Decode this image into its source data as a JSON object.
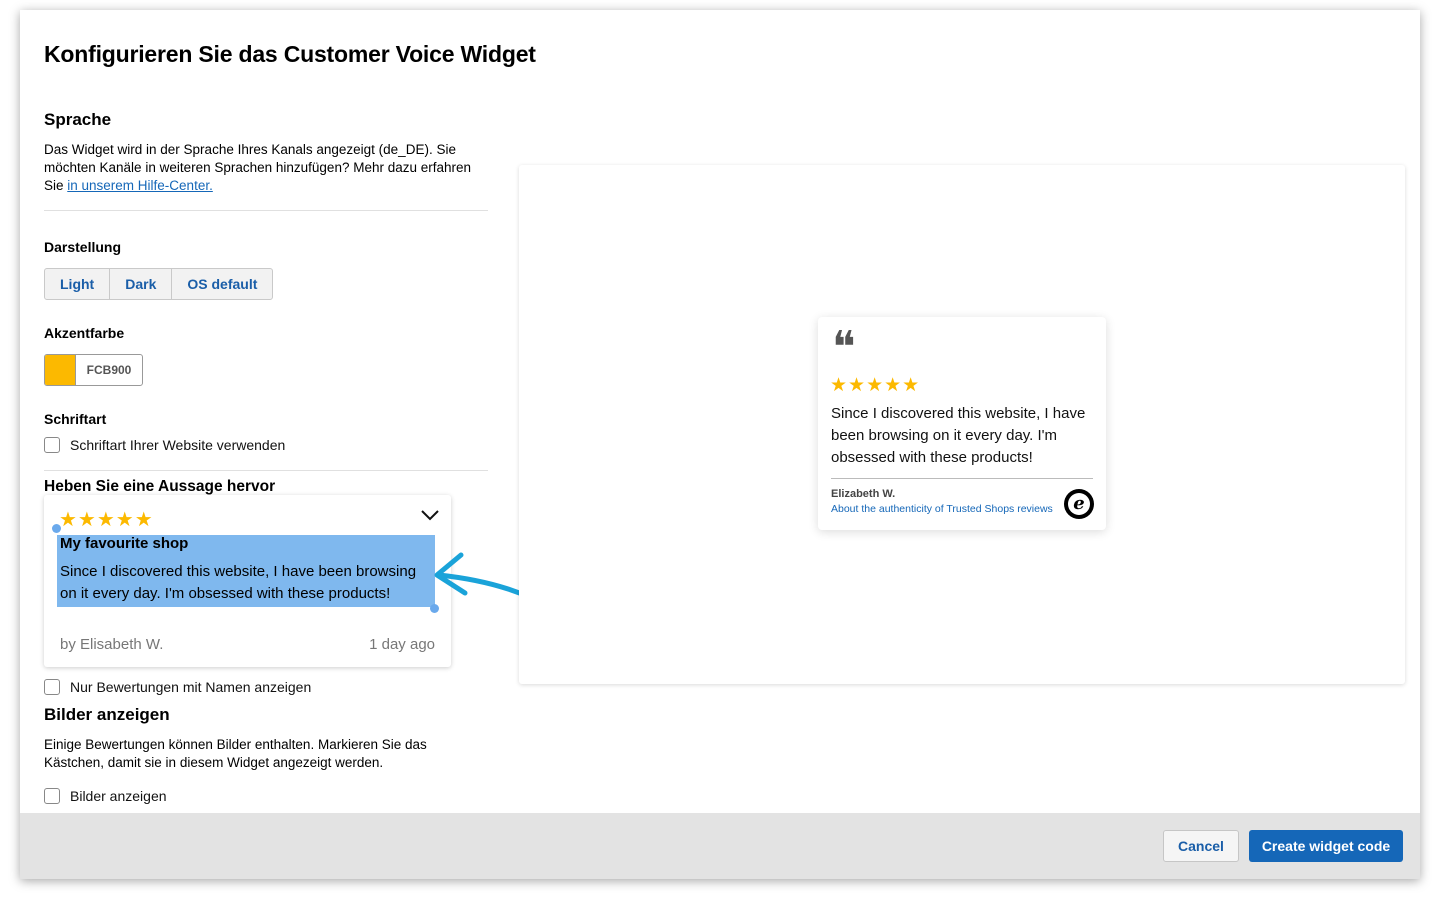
{
  "dialog": {
    "title": "Konfigurieren Sie das Customer Voice Widget"
  },
  "language": {
    "heading": "Sprache",
    "description": "Das Widget wird in der Sprache Ihres Kanals angezeigt (de_DE). Sie möchten Kanäle in weiteren Sprachen hinzufügen? Mehr dazu erfahren Sie ",
    "link_label": "in unserem Hilfe-Center."
  },
  "appearance": {
    "heading": "Darstellung",
    "options": [
      "Light",
      "Dark",
      "OS default"
    ]
  },
  "accent": {
    "heading": "Akzentfarbe",
    "value": "FCB900",
    "color": "#FCB900"
  },
  "font": {
    "heading": "Schriftart",
    "checkbox_label": "Schriftart Ihrer Website verwenden",
    "checked": false
  },
  "highlight": {
    "heading": "Heben Sie eine Aussage hervor",
    "review": {
      "stars": "★★★★★",
      "rating": 5,
      "title": "My favourite shop",
      "text_line1": "Since I discovered this website, I have been browsing",
      "text_line2": "on it every day. I'm obsessed with these products!",
      "author": "by Elisabeth W.",
      "time": "1 day ago"
    },
    "names_only_label": "Nur Bewertungen mit Namen anzeigen",
    "names_only_checked": false
  },
  "images": {
    "heading": "Bilder anzeigen",
    "description": "Einige Bewertungen können Bilder enthalten. Markieren Sie das Kästchen, damit sie in diesem Widget angezeigt werden.",
    "checkbox_label": "Bilder anzeigen",
    "checked": false
  },
  "preview": {
    "quote_mark": "❝",
    "stars": "★★★★★",
    "rating": 5,
    "text": "Since I discovered this website, I have been browsing on it every day. I'm obsessed with these products!",
    "author": "Elizabeth W.",
    "authenticity_link": "About the authenticity of Trusted Shops reviews",
    "badge_letter": "e"
  },
  "footer": {
    "cancel_label": "Cancel",
    "create_label": "Create widget code"
  },
  "colors": {
    "accent": "#FCB900",
    "primary": "#1567B8",
    "selection": "#7FB8EE",
    "annotation_arrow": "#1AA3D9"
  }
}
